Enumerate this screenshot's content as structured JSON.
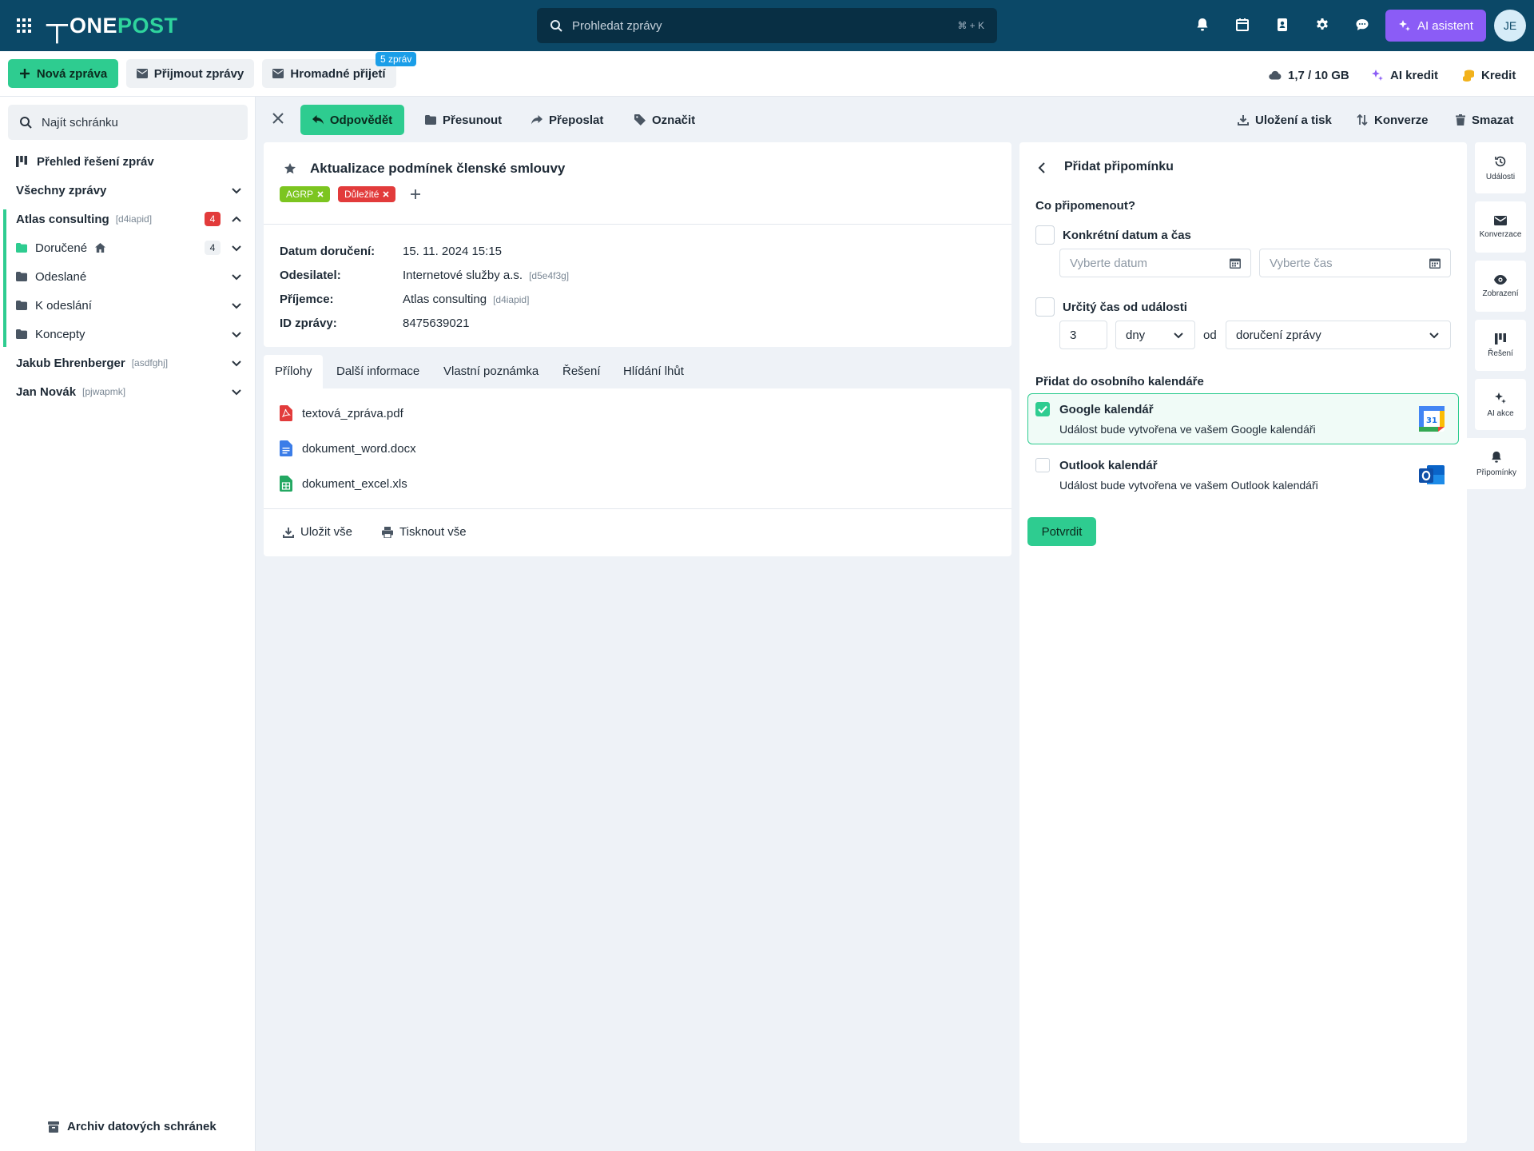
{
  "topbar": {
    "logo_one": "ONE",
    "logo_post": "POST",
    "search_placeholder": "Prohledat zprávy",
    "search_shortcut": "⌘ + K",
    "ai_assistant": "AI asistent",
    "avatar_initials": "JE"
  },
  "actionbar": {
    "new_message": "Nová zpráva",
    "receive_messages": "Přijmout zprávy",
    "bulk_receive": "Hromadné přijetí",
    "bulk_badge": "5 zpráv",
    "storage": "1,7 / 10 GB",
    "ai_credit": "AI kredit",
    "credit": "Kredit"
  },
  "sidebar": {
    "search_placeholder": "Najít schránku",
    "overview": "Přehled řešení zpráv",
    "all_messages": "Všechny zprávy",
    "boxes": [
      {
        "name": "Atlas consulting",
        "code": "[d4iapid]",
        "badge": "4"
      },
      {
        "name": "Jakub Ehrenberger",
        "code": "[asdfghj]"
      },
      {
        "name": "Jan Novák",
        "code": "[pjwapmk]"
      }
    ],
    "folders": [
      {
        "name": "Doručené",
        "badge": "4"
      },
      {
        "name": "Odeslané"
      },
      {
        "name": "K odeslání"
      },
      {
        "name": "Koncepty"
      }
    ],
    "archive": "Archiv datových schránek"
  },
  "toolbar": {
    "reply": "Odpovědět",
    "move": "Přesunout",
    "forward": "Přeposlat",
    "mark": "Označit",
    "save_print": "Uložení a tisk",
    "conversion": "Konverze",
    "delete": "Smazat"
  },
  "message": {
    "subject": "Aktualizace podmínek členské smlouvy",
    "tags": [
      {
        "label": "AGRP",
        "color": "#7cc520"
      },
      {
        "label": "Důležité",
        "color": "#e23b3b"
      }
    ],
    "meta": [
      {
        "label": "Datum doručení:",
        "value": "15. 11. 2024 15:15",
        "code": ""
      },
      {
        "label": "Odesilatel:",
        "value": "Internetové služby a.s.",
        "code": "[d5e4f3g]"
      },
      {
        "label": "Příjemce:",
        "value": "Atlas consulting",
        "code": "[d4iapid]"
      },
      {
        "label": "ID zprávy:",
        "value": "8475639021",
        "code": ""
      }
    ],
    "tabs": [
      "Přílohy",
      "Další informace",
      "Vlastní poznámka",
      "Řešení",
      "Hlídání lhůt"
    ],
    "files": [
      "textová_zpráva.pdf",
      "dokument_word.docx",
      "dokument_excel.xls"
    ],
    "save_all": "Uložit vše",
    "print_all": "Tisknout vše"
  },
  "reminder": {
    "title": "Přidat připomínku",
    "what": "Co připomenout?",
    "specific": "Konkrétní datum a čas",
    "date_placeholder": "Vyberte datum",
    "time_placeholder": "Vyberte čas",
    "relative": "Určitý čas od události",
    "amount": "3",
    "unit": "dny",
    "from": "od",
    "event": "doručení zprávy",
    "calendar_heading": "Přidat do osobního kalendáře",
    "google_title": "Google kalendář",
    "google_desc": "Událost bude vytvořena ve vašem Google kalendáři",
    "outlook_title": "Outlook kalendář",
    "outlook_desc": "Událost bude vytvořena ve vašem Outlook kalendáři",
    "confirm": "Potvrdit"
  },
  "rail": [
    "Události",
    "Konverzace",
    "Zobrazení",
    "Řešení",
    "AI akce",
    "Připomínky"
  ],
  "colors": {
    "topbar": "#0b4867",
    "accent_green": "#2ecc90",
    "ai_purple": "#8b5cf6",
    "badge_blue": "#1a9ee8",
    "danger": "#e23b3b"
  }
}
